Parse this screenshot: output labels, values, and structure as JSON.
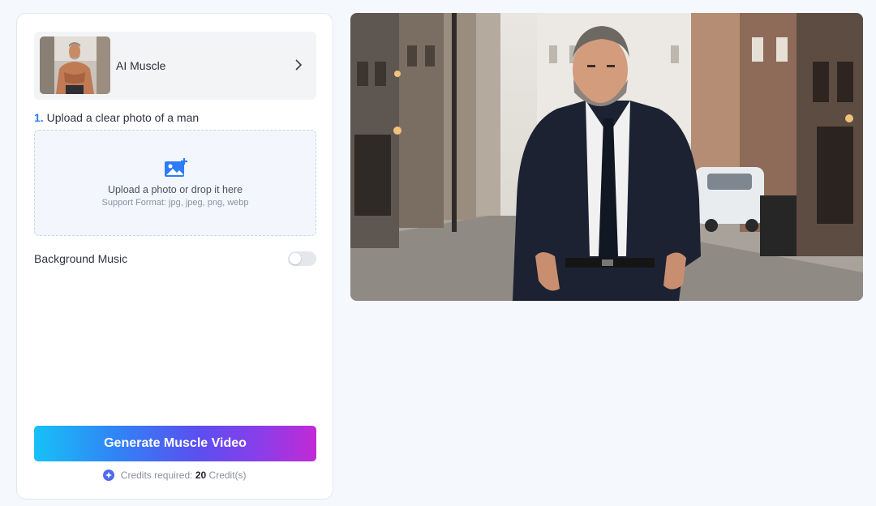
{
  "effect": {
    "label": "AI Muscle",
    "thumbnail_icon": "muscular-man-thumbnail"
  },
  "upload": {
    "step_number": "1.",
    "step_label": "Upload a clear photo of a man",
    "title": "Upload a photo or drop it here",
    "formats": "Support Format: jpg, jpeg, png, webp",
    "icon": "image-add-icon"
  },
  "music": {
    "label": "Background Music",
    "enabled": false
  },
  "generate": {
    "label": "Generate Muscle Video"
  },
  "credits": {
    "prefix": "Credits required:",
    "amount": "20",
    "unit": "Credit(s)"
  },
  "preview": {
    "icon": "man-in-suit-street-photo"
  },
  "colors": {
    "accent": "#2e7cf6",
    "gradient_start": "#17c1f7",
    "gradient_end": "#c12ad6"
  }
}
